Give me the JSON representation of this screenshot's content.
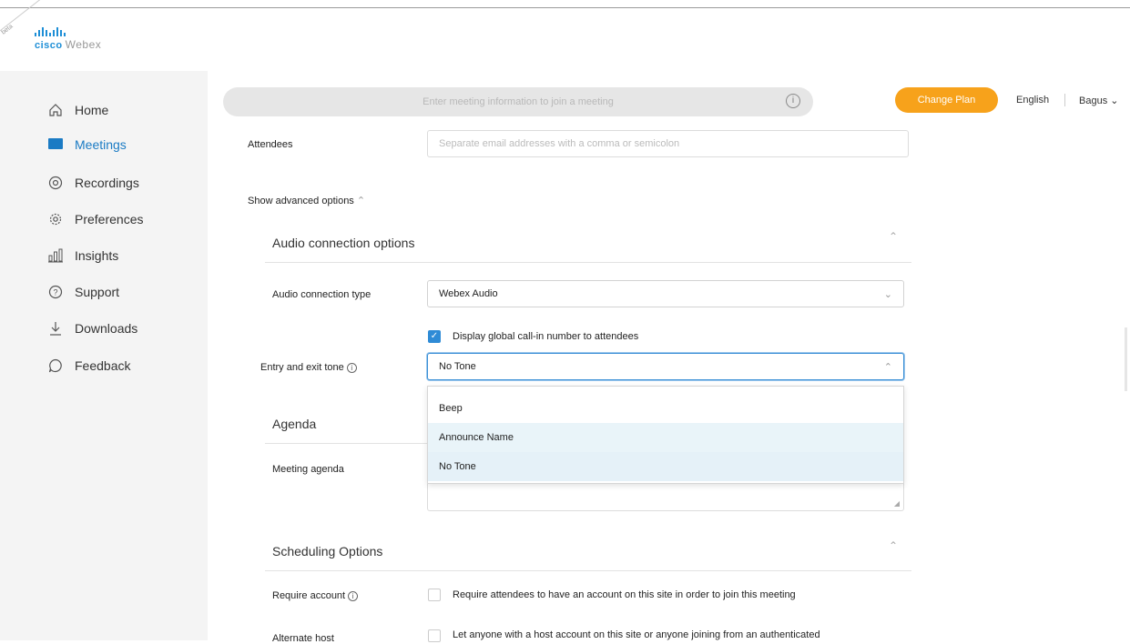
{
  "corner_tag": "beta",
  "logo": {
    "brand": "cisco",
    "product": "Webex"
  },
  "sidebar": {
    "items": [
      {
        "label": "Home",
        "icon": "home-icon"
      },
      {
        "label": "Meetings",
        "icon": "meetings-icon",
        "active": true
      },
      {
        "label": "Recordings",
        "icon": "recordings-icon"
      },
      {
        "label": "Preferences",
        "icon": "gear-icon"
      },
      {
        "label": "Insights",
        "icon": "insights-icon"
      },
      {
        "label": "Support",
        "icon": "help-icon"
      },
      {
        "label": "Downloads",
        "icon": "download-icon"
      },
      {
        "label": "Feedback",
        "icon": "feedback-icon"
      }
    ]
  },
  "header": {
    "search_placeholder": "Enter meeting information to join a meeting",
    "info_glyph": "i",
    "change_plan_label": "Change Plan",
    "language": "English",
    "user": "Bagus"
  },
  "form": {
    "attendees_label": "Attendees",
    "attendees_placeholder": "Separate email addresses with a comma or semicolon",
    "advanced_toggle": "Show advanced options",
    "audio_section_title": "Audio connection options",
    "audio_type_label": "Audio connection type",
    "audio_type_value": "Webex Audio",
    "global_callin_label": "Display global call-in number to attendees",
    "tone_label": "Entry and exit tone",
    "tone_value": "No Tone",
    "tone_options": [
      "Beep",
      "Announce Name",
      "No Tone"
    ],
    "agenda_section_title": "Agenda",
    "meeting_agenda_label": "Meeting agenda",
    "scheduling_section_title": "Scheduling Options",
    "require_account_label": "Require account",
    "require_account_text": "Require attendees to have an account on this site in order to join this meeting",
    "alternate_host_label": "Alternate host",
    "alternate_host_text": "Let anyone with a host account on this site or anyone joining from an authenticated"
  },
  "colors": {
    "accent": "#1b7bc4",
    "change_plan": "#f7a21b",
    "checkbox": "#2f8bd6"
  }
}
